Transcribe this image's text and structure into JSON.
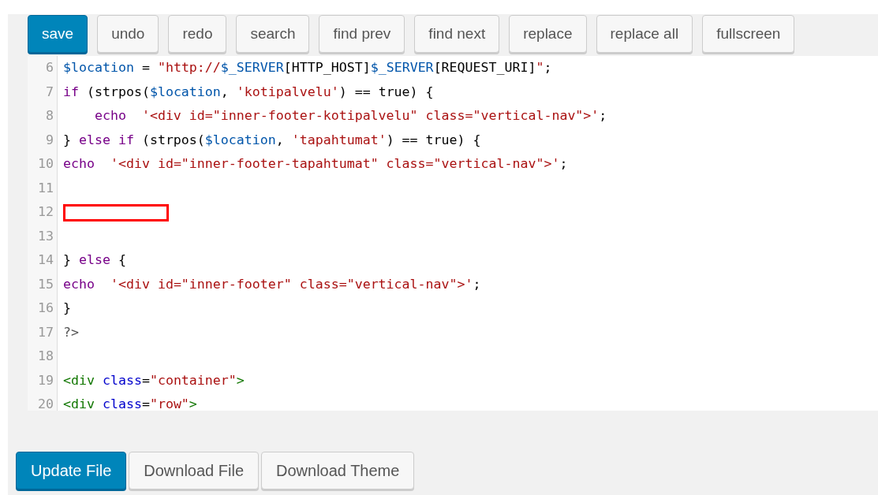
{
  "toolbar": [
    {
      "label": "save",
      "kind": "primary"
    },
    {
      "label": "undo",
      "kind": "secondary"
    },
    {
      "label": "redo",
      "kind": "secondary"
    },
    {
      "label": "search",
      "kind": "secondary"
    },
    {
      "label": "find prev",
      "kind": "secondary"
    },
    {
      "label": "find next",
      "kind": "secondary"
    },
    {
      "label": "replace",
      "kind": "secondary"
    },
    {
      "label": "replace all",
      "kind": "secondary"
    },
    {
      "label": "fullscreen",
      "kind": "secondary"
    }
  ],
  "editor": {
    "lines": [
      {
        "number": "6",
        "marked": false,
        "tokens": [
          {
            "kind": "var",
            "text": "$location"
          },
          {
            "kind": "plain",
            "text": " = "
          },
          {
            "kind": "str",
            "text": "\"http://"
          },
          {
            "kind": "var",
            "text": "$_SERVER"
          },
          {
            "kind": "plain",
            "text": "[HTTP_HOST]"
          },
          {
            "kind": "var",
            "text": "$_SERVER"
          },
          {
            "kind": "plain",
            "text": "[REQUEST_URI]"
          },
          {
            "kind": "str",
            "text": "\""
          },
          {
            "kind": "plain",
            "text": ";"
          }
        ]
      },
      {
        "number": "7",
        "marked": false,
        "tokens": [
          {
            "kind": "kw",
            "text": "if"
          },
          {
            "kind": "plain",
            "text": " (strpos("
          },
          {
            "kind": "var",
            "text": "$location"
          },
          {
            "kind": "plain",
            "text": ", "
          },
          {
            "kind": "str",
            "text": "'kotipalvelu'"
          },
          {
            "kind": "plain",
            "text": ") == true) {"
          }
        ]
      },
      {
        "number": "8",
        "marked": false,
        "tokens": [
          {
            "kind": "kw",
            "text": "    echo  "
          },
          {
            "kind": "str",
            "text": "'<div id=\"inner-footer-kotipalvelu\" class=\"vertical-nav\">'"
          },
          {
            "kind": "plain",
            "text": ";"
          }
        ]
      },
      {
        "number": "9",
        "marked": false,
        "tokens": [
          {
            "kind": "plain",
            "text": "} "
          },
          {
            "kind": "kw",
            "text": "else if"
          },
          {
            "kind": "plain",
            "text": " (strpos("
          },
          {
            "kind": "var",
            "text": "$location"
          },
          {
            "kind": "plain",
            "text": ", "
          },
          {
            "kind": "str",
            "text": "'tapahtumat'"
          },
          {
            "kind": "plain",
            "text": ") == true) {"
          }
        ]
      },
      {
        "number": "10",
        "marked": false,
        "tokens": [
          {
            "kind": "kw",
            "text": "echo  "
          },
          {
            "kind": "str",
            "text": "'<div id=\"inner-footer-tapahtumat\" class=\"vertical-nav\">'"
          },
          {
            "kind": "plain",
            "text": ";"
          }
        ]
      },
      {
        "number": "11",
        "marked": false
      },
      {
        "number": "12",
        "marked": true
      },
      {
        "number": "13",
        "marked": false
      },
      {
        "number": "14",
        "marked": false,
        "tokens": [
          {
            "kind": "plain",
            "text": "} "
          },
          {
            "kind": "kw",
            "text": "else"
          },
          {
            "kind": "plain",
            "text": " {"
          }
        ]
      },
      {
        "number": "15",
        "marked": false,
        "tokens": [
          {
            "kind": "kw",
            "text": "echo  "
          },
          {
            "kind": "str",
            "text": "'<div id=\"inner-footer\" class=\"vertical-nav\">'"
          },
          {
            "kind": "plain",
            "text": ";"
          }
        ]
      },
      {
        "number": "16",
        "marked": false,
        "tokens": [
          {
            "kind": "plain",
            "text": "}"
          }
        ]
      },
      {
        "number": "17",
        "marked": false,
        "tokens": [
          {
            "kind": "meta",
            "text": "?>"
          }
        ]
      },
      {
        "number": "18",
        "marked": false
      },
      {
        "number": "19",
        "marked": false,
        "tokens": [
          {
            "kind": "tag",
            "text": "<div "
          },
          {
            "kind": "attr",
            "text": "class"
          },
          {
            "kind": "plain",
            "text": "="
          },
          {
            "kind": "str",
            "text": "\"container\""
          },
          {
            "kind": "tag",
            "text": ">"
          }
        ]
      },
      {
        "number": "20",
        "marked": false,
        "tokens": [
          {
            "kind": "tag",
            "text": "<div "
          },
          {
            "kind": "attr",
            "text": "class"
          },
          {
            "kind": "plain",
            "text": "="
          },
          {
            "kind": "str",
            "text": "\"row\""
          },
          {
            "kind": "tag",
            "text": ">"
          }
        ]
      }
    ]
  },
  "actions": [
    {
      "label": "Update File",
      "kind": "primary"
    },
    {
      "label": "Download File",
      "kind": "secondary"
    },
    {
      "label": "Download Theme",
      "kind": "secondary"
    }
  ]
}
